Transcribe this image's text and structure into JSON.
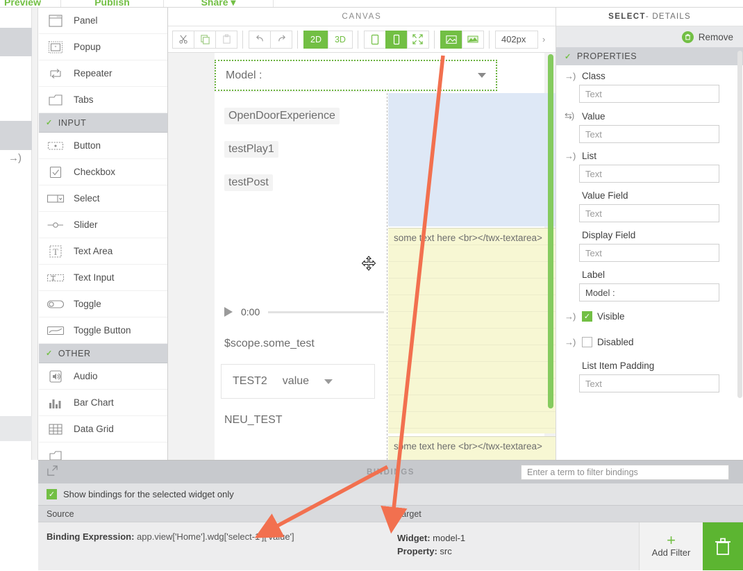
{
  "topbar": {
    "tabs": [
      {
        "label": "Preview"
      },
      {
        "label": "Publish"
      },
      {
        "label": "Share ▾"
      },
      {
        "label": ""
      }
    ]
  },
  "palette": {
    "items": [
      {
        "label": "Panel",
        "icon": "panel-icon",
        "type": "item"
      },
      {
        "label": "Popup",
        "icon": "popup-icon",
        "type": "item"
      },
      {
        "label": "Repeater",
        "icon": "repeater-icon",
        "type": "item"
      },
      {
        "label": "Tabs",
        "icon": "tabs-icon",
        "type": "item"
      },
      {
        "label": "INPUT",
        "icon": "chevron-down-icon",
        "type": "section"
      },
      {
        "label": "Button",
        "icon": "button-icon",
        "type": "item"
      },
      {
        "label": "Checkbox",
        "icon": "checkbox-icon",
        "type": "item"
      },
      {
        "label": "Select",
        "icon": "select-icon",
        "type": "item"
      },
      {
        "label": "Slider",
        "icon": "slider-icon",
        "type": "item"
      },
      {
        "label": "Text Area",
        "icon": "text-area-icon",
        "type": "item"
      },
      {
        "label": "Text Input",
        "icon": "text-input-icon",
        "type": "item"
      },
      {
        "label": "Toggle",
        "icon": "toggle-icon",
        "type": "item"
      },
      {
        "label": "Toggle Button",
        "icon": "toggle-button-icon",
        "type": "item"
      },
      {
        "label": "OTHER",
        "icon": "chevron-down-icon",
        "type": "section"
      },
      {
        "label": "Audio",
        "icon": "audio-icon",
        "type": "item"
      },
      {
        "label": "Bar Chart",
        "icon": "bar-chart-icon",
        "type": "item"
      },
      {
        "label": "Data Grid",
        "icon": "data-grid-icon",
        "type": "item"
      }
    ]
  },
  "canvas": {
    "title": "CANVAS",
    "toolbar": {
      "cut": "✂",
      "copy": "copy",
      "paste": "paste",
      "undo": "↶",
      "redo": "↷",
      "view_2d": "2D",
      "view_3d": "3D",
      "device_tablet": "tablet",
      "device_phone": "phone",
      "device_fullscreen": "fullscreen",
      "media_image_on": "image",
      "media_image_off": "landscape",
      "width_value": "402px",
      "more": "›"
    },
    "selected_widget": {
      "label": "Model :",
      "caret": "chevron-down-icon"
    },
    "widgets": [
      {
        "label": "OpenDoorExperience"
      },
      {
        "label": "testPlay1"
      },
      {
        "label": "testPost"
      }
    ],
    "audio": {
      "time": "0:00",
      "play": "play-icon"
    },
    "scope_label": "$scope.some_test",
    "datagrid": {
      "col1": "TEST2",
      "col2": "value"
    },
    "neu_label": "NEU_TEST",
    "textarea_top": "some text here <br></twx-textarea>",
    "textarea_bottom": "some text here <br></twx-textarea>"
  },
  "properties": {
    "header_strong": "SELECT",
    "header_rest": " - DETAILS",
    "remove_label": "Remove",
    "section_label": "PROPERTIES",
    "fields": [
      {
        "label": "Class",
        "value": "",
        "placeholder": "Text",
        "bindable": true,
        "bind_icon": "binding-arrow-icon"
      },
      {
        "label": "Value",
        "value": "",
        "placeholder": "Text",
        "bindable": true,
        "bind_icon": "binding-two-way-icon"
      },
      {
        "label": "List",
        "value": "",
        "placeholder": "Text",
        "bindable": true,
        "bind_icon": "binding-arrow-icon"
      },
      {
        "label": "Value Field",
        "value": "",
        "placeholder": "Text",
        "bindable": false,
        "bind_icon": ""
      },
      {
        "label": "Display Field",
        "value": "",
        "placeholder": "Text",
        "bindable": false,
        "bind_icon": ""
      },
      {
        "label": "Label",
        "value": "Model :",
        "placeholder": "Text",
        "bindable": false,
        "bind_icon": ""
      },
      {
        "label": "List Item Padding",
        "value": "",
        "placeholder": "Text",
        "bindable": false,
        "bind_icon": ""
      }
    ],
    "checkboxes": [
      {
        "label": "Visible",
        "checked": true,
        "bind_icon": "binding-arrow-icon"
      },
      {
        "label": "Disabled",
        "checked": false,
        "bind_icon": "binding-arrow-icon"
      }
    ]
  },
  "bindings": {
    "title": "BINDINGS",
    "expand_icon": "expand-icon",
    "filter_placeholder": "Enter a term to filter bindings",
    "show_selected_only": {
      "label": "Show bindings for the selected widget only",
      "checked": true
    },
    "columns": {
      "source": "Source",
      "target": "Target"
    },
    "row": {
      "source_label": "Binding Expression:",
      "source_value": "app.view['Home'].wdg['select-1']['value']",
      "target_widget_label": "Widget:",
      "target_widget_value": "model-1",
      "target_property_label": "Property:",
      "target_property_value": "src"
    },
    "add_filter_label": "Add Filter",
    "delete_icon": "trash-icon"
  },
  "colors": {
    "accent_green": "#72bf44",
    "annotation_arrow": "#f2704f",
    "section_gray": "#d2d4d8",
    "panel_blue": "#dee8f6",
    "panel_yellow": "#f7f7d3"
  }
}
